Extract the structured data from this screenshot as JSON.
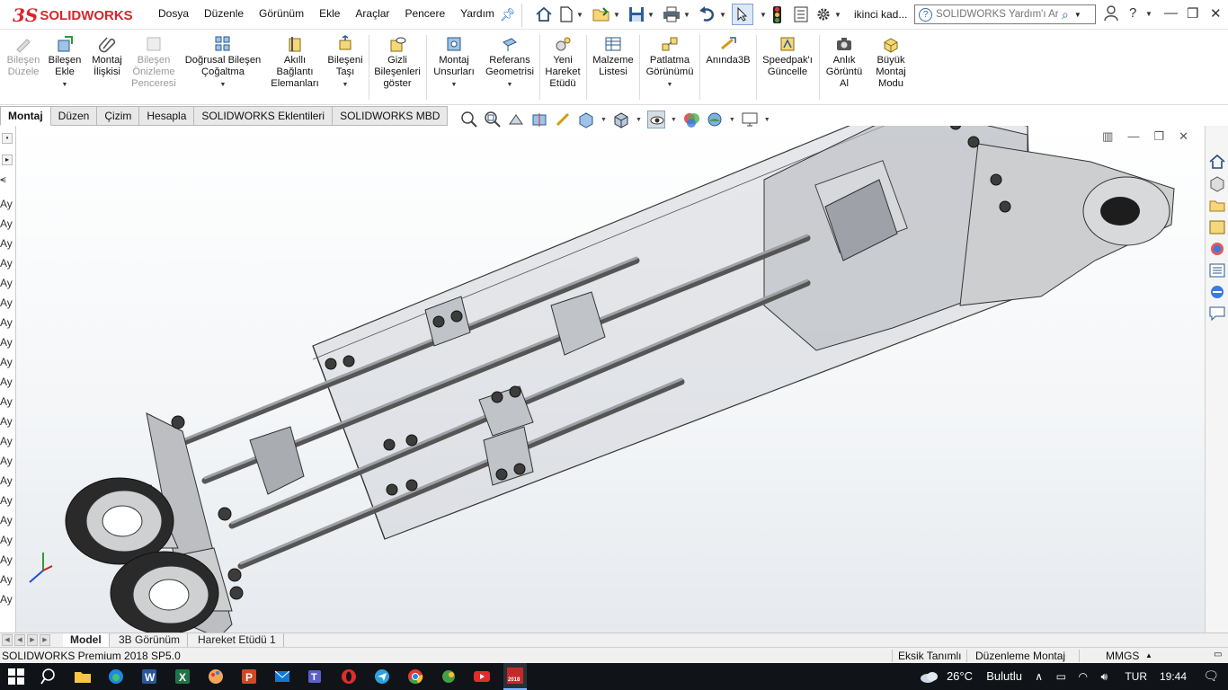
{
  "app": {
    "brand_ds": "3S",
    "brand_name": "SOLIDWORKS"
  },
  "menu": [
    "Dosya",
    "Düzenle",
    "Görünüm",
    "Ekle",
    "Araçlar",
    "Pencere",
    "Yardım"
  ],
  "quick_access": {
    "user_name": "ikinci kad...",
    "help_search_placeholder": "SOLIDWORKS Yardım'ı Ara"
  },
  "ribbon": {
    "buttons": [
      {
        "label": "Bileşen\nDüzele",
        "enabled": false
      },
      {
        "label": "Bileşen\nEkle",
        "enabled": true
      },
      {
        "label": "Montaj\nİlişkisi",
        "enabled": true
      },
      {
        "label": "Bileşen\nÖnizleme\nPenceresi",
        "enabled": false
      },
      {
        "label": "Doğrusal Bileşen\nÇoğaltma",
        "enabled": true
      },
      {
        "label": "Akıllı\nBağlantı\nElemanları",
        "enabled": true
      },
      {
        "label": "Bileşeni\nTaşı",
        "enabled": true
      },
      {
        "label": "Gizli\nBileşenleri\ngöster",
        "enabled": true
      },
      {
        "label": "Montaj\nUnsurları",
        "enabled": true
      },
      {
        "label": "Referans\nGeometrisi",
        "enabled": true
      },
      {
        "label": "Yeni\nHareket\nEtüdü",
        "enabled": true
      },
      {
        "label": "Malzeme\nListesi",
        "enabled": true
      },
      {
        "label": "Patlatma\nGörünümü",
        "enabled": true
      },
      {
        "label": "Anında3B",
        "enabled": true
      },
      {
        "label": "Speedpak'ı\nGüncelle",
        "enabled": true
      },
      {
        "label": "Anlık\nGörüntü\nAl",
        "enabled": true
      },
      {
        "label": "Büyük\nMontaj\nModu",
        "enabled": true
      }
    ]
  },
  "tabs": [
    "Montaj",
    "Düzen",
    "Çizim",
    "Hesapla",
    "SOLIDWORKS Eklentileri",
    "SOLIDWORKS MBD"
  ],
  "active_tab": "Montaj",
  "feature_tree": {
    "item_prefix": "Ay"
  },
  "model_tabs": [
    "Model",
    "3B Görünüm",
    "Hareket Etüdü 1"
  ],
  "status": {
    "product": "SOLIDWORKS Premium 2018 SP5.0",
    "definition": "Eksik Tanımlı",
    "mode": "Düzenleme Montaj",
    "units": "MMGS"
  },
  "taskbar": {
    "weather": "26°C",
    "weather_desc": "Bulutlu",
    "language": "TUR",
    "time": "19:44",
    "sw_badge": "2018"
  },
  "colors": {
    "brand_red": "#d7262c",
    "taskbar_bg": "#101418"
  }
}
